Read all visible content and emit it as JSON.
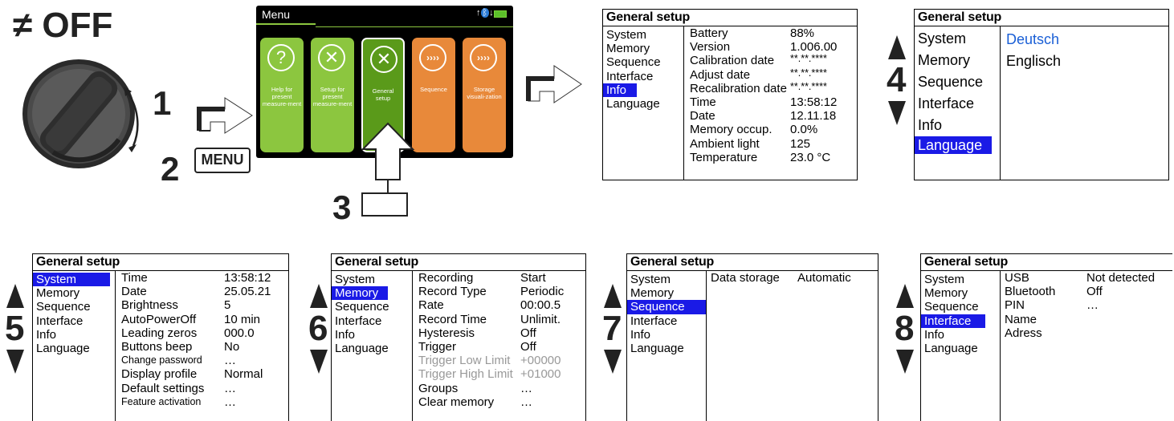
{
  "dial": {
    "label": "OFF",
    "step1": "1",
    "step2": "2",
    "menu_key": "MENU"
  },
  "menu_screen": {
    "title": "Menu",
    "tiles": [
      {
        "icon": "?",
        "label": "Help for present measure-ment",
        "color": "#8cc63f"
      },
      {
        "icon": "✕",
        "label": "Setup for present measure-ment",
        "color": "#8cc63f"
      },
      {
        "icon": "✕",
        "label": "General setup",
        "color": "#5a9a1a"
      },
      {
        "icon": "››››",
        "label": "Sequence",
        "color": "#e8893a"
      },
      {
        "icon": "››››",
        "label": "Storage visuali-zation",
        "color": "#e8893a"
      }
    ],
    "step3": "3"
  },
  "nav": [
    "System",
    "Memory",
    "Sequence",
    "Interface",
    "Info",
    "Language"
  ],
  "panel_info": {
    "title": "General setup",
    "selected": 4,
    "rows": [
      {
        "k": "Battery",
        "v": "88%"
      },
      {
        "k": "Version",
        "v": "1.006.00"
      },
      {
        "k": "Calibration date",
        "v": "**.**.****"
      },
      {
        "k": "Adjust date",
        "v": "**.**.****"
      },
      {
        "k": "Recalibration date",
        "v": "**.**.****"
      },
      {
        "k": "Time",
        "v": "13:58:12"
      },
      {
        "k": "Date",
        "v": "12.11.18"
      },
      {
        "k": "Memory occup.",
        "v": "0.0%"
      },
      {
        "k": "Ambient light",
        "v": "125"
      },
      {
        "k": "Temperature",
        "v": "23.0 °C"
      }
    ]
  },
  "panel_lang": {
    "title": "General setup",
    "selected": 5,
    "options": [
      "Deutsch",
      "Englisch"
    ],
    "step": "4"
  },
  "panel_system": {
    "title": "General setup",
    "selected": 0,
    "step": "5",
    "rows": [
      {
        "k": "Time",
        "v": "13:58:12"
      },
      {
        "k": "Date",
        "v": "25.05.21"
      },
      {
        "k": "Brightness",
        "v": "5"
      },
      {
        "k": "AutoPowerOff",
        "v": "10 min"
      },
      {
        "k": "Leading zeros",
        "v": "000.0"
      },
      {
        "k": "Buttons beep",
        "v": "No"
      },
      {
        "k": "Change password",
        "v": "…"
      },
      {
        "k": "Display profile",
        "v": "Normal"
      },
      {
        "k": "Default settings",
        "v": "…"
      },
      {
        "k": "Feature activation",
        "v": "…"
      }
    ]
  },
  "panel_memory": {
    "title": "General setup",
    "selected": 1,
    "step": "6",
    "rows": [
      {
        "k": "Recording",
        "v": "Start"
      },
      {
        "k": "Record Type",
        "v": "Periodic"
      },
      {
        "k": "Rate",
        "v": "00:00.5"
      },
      {
        "k": "Record Time",
        "v": "Unlimit."
      },
      {
        "k": "Hysteresis",
        "v": "Off"
      },
      {
        "k": "Trigger",
        "v": "Off"
      },
      {
        "k": "Trigger Low Limit",
        "v": "+00000"
      },
      {
        "k": "Trigger High Limit",
        "v": "+01000"
      },
      {
        "k": "Groups",
        "v": "…"
      },
      {
        "k": "Clear memory",
        "v": "…"
      }
    ]
  },
  "panel_sequence": {
    "title": "General setup",
    "selected": 2,
    "step": "7",
    "rows": [
      {
        "k": "Data storage",
        "v": "Automatic"
      }
    ]
  },
  "panel_interface": {
    "title": "General setup",
    "selected": 3,
    "step": "8",
    "rows": [
      {
        "k": "USB",
        "v": "Not detected"
      },
      {
        "k": "Bluetooth",
        "v": "Off"
      },
      {
        "k": "PIN",
        "v": "…"
      },
      {
        "k": "Name",
        "v": ""
      },
      {
        "k": "Adress",
        "v": ""
      }
    ]
  },
  "colors": {
    "select": "#1a1ae6",
    "lang_option": "#1a5fd6"
  }
}
